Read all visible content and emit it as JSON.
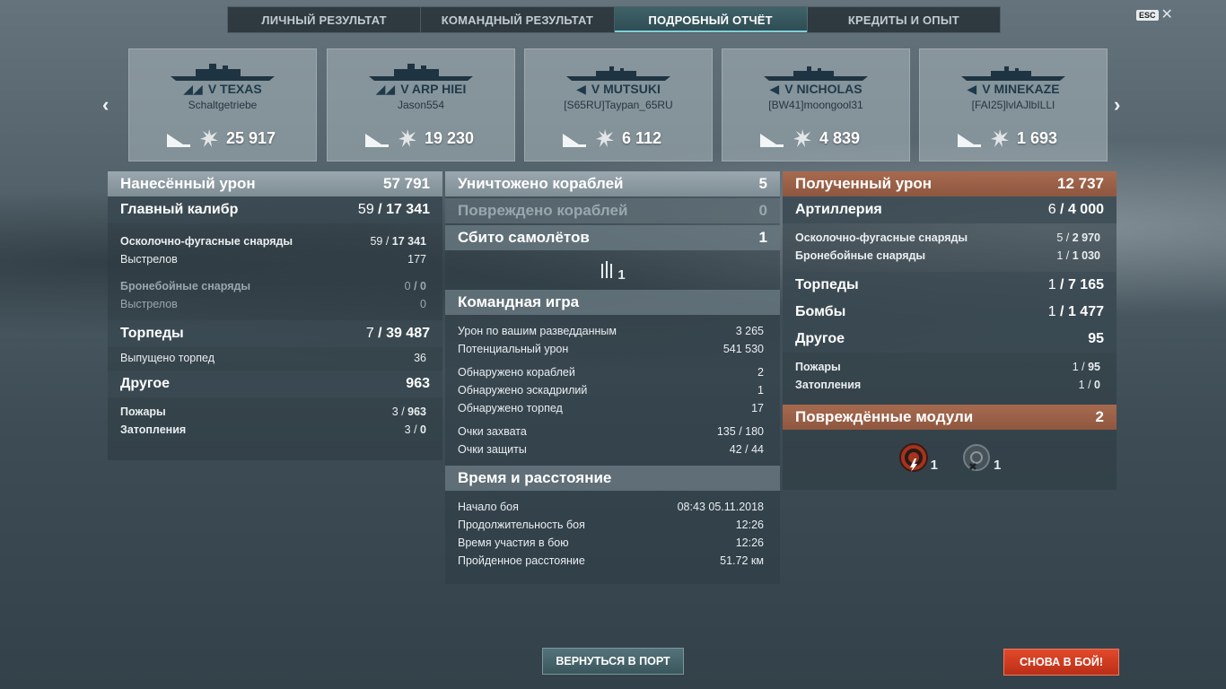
{
  "tabs": [
    "ЛИЧНЫЙ РЕЗУЛЬТАТ",
    "КОМАНДНЫЙ РЕЗУЛЬТАТ",
    "ПОДРОБНЫЙ ОТЧЁТ",
    "КРЕДИТЫ И ОПЫТ"
  ],
  "active_tab": 2,
  "esc_label": "ESC",
  "cards": [
    {
      "tier": "V",
      "ship": "TEXAS",
      "player": "Schaltgetriebe",
      "damage": "25 917",
      "ship_class": "battleship-icon"
    },
    {
      "tier": "V",
      "ship": "ARP HIEI",
      "player": "Jason554",
      "damage": "19 230",
      "ship_class": "battleship-icon"
    },
    {
      "tier": "V",
      "ship": "MUTSUKI",
      "player": "[S65RU]Taypan_65RU",
      "damage": "6 112",
      "ship_class": "destroyer-icon"
    },
    {
      "tier": "V",
      "ship": "NICHOLAS",
      "player": "[BW41]moongool31",
      "damage": "4 839",
      "ship_class": "destroyer-icon"
    },
    {
      "tier": "V",
      "ship": "MINEKAZE",
      "player": "[FAI25]lvlAJlbILLI",
      "damage": "1 693",
      "ship_class": "destroyer-icon"
    }
  ],
  "left": {
    "header": {
      "label": "Нанесённый урон",
      "value": "57 791"
    },
    "main_battery": {
      "label": "Главный калибр",
      "hits": "59",
      "dmg": "17 341"
    },
    "he": {
      "label": "Осколочно-фугасные снаряды",
      "hits": "59",
      "dmg": "17 341"
    },
    "he_shots": {
      "label": "Выстрелов",
      "value": "177"
    },
    "ap": {
      "label": "Бронебойные снаряды",
      "hits": "0",
      "dmg": "0"
    },
    "ap_shots": {
      "label": "Выстрелов",
      "value": "0"
    },
    "torpedoes": {
      "label": "Торпеды",
      "hits": "7",
      "dmg": "39 487"
    },
    "torps_launched": {
      "label": "Выпущено торпед",
      "value": "36"
    },
    "other": {
      "label": "Другое",
      "value": "963"
    },
    "fires": {
      "label": "Пожары",
      "hits": "3",
      "dmg": "963"
    },
    "floods": {
      "label": "Затопления",
      "hits": "3",
      "dmg": "0"
    }
  },
  "middle": {
    "destroyed": {
      "label": "Уничтожено кораблей",
      "value": "5"
    },
    "damaged": {
      "label": "Повреждено кораблей",
      "value": "0"
    },
    "planes": {
      "label": "Сбито самолётов",
      "value": "1"
    },
    "planes_icon_count": "1",
    "team": {
      "label": "Командная игра",
      "rows": [
        {
          "label": "Урон по вашим разведданным",
          "value": "3 265"
        },
        {
          "label": "Потенциальный урон",
          "value": "541 530"
        },
        {
          "label": "Обнаружено кораблей",
          "value": "2"
        },
        {
          "label": "Обнаружено эскадрилий",
          "value": "1"
        },
        {
          "label": "Обнаружено торпед",
          "value": "17"
        },
        {
          "label": "Очки захвата",
          "value": "135 / 180"
        },
        {
          "label": "Очки защиты",
          "value": "42 / 44"
        }
      ]
    },
    "time": {
      "label": "Время и расстояние",
      "rows": [
        {
          "label": "Начало боя",
          "value": "08:43  05.11.2018"
        },
        {
          "label": "Продолжительность боя",
          "value": "12:26"
        },
        {
          "label": "Время участия в бою",
          "value": "12:26"
        },
        {
          "label": "Пройденное расстояние",
          "value": "51.72 км"
        }
      ]
    }
  },
  "right": {
    "header": {
      "label": "Полученный урон",
      "value": "12 737"
    },
    "artillery": {
      "label": "Артиллерия",
      "hits": "6",
      "dmg": "4 000"
    },
    "he": {
      "label": "Осколочно-фугасные снаряды",
      "hits": "5",
      "dmg": "2 970"
    },
    "ap": {
      "label": "Бронебойные снаряды",
      "hits": "1",
      "dmg": "1 030"
    },
    "torpedoes": {
      "label": "Торпеды",
      "hits": "1",
      "dmg": "7 165"
    },
    "bombs": {
      "label": "Бомбы",
      "hits": "1",
      "dmg": "1 477"
    },
    "other": {
      "label": "Другое",
      "value": "95"
    },
    "fires": {
      "label": "Пожары",
      "hits": "1",
      "dmg": "95"
    },
    "floods": {
      "label": "Затопления",
      "hits": "1",
      "dmg": "0"
    },
    "modules": {
      "label": "Повреждённые модули",
      "value": "2",
      "engine_count": "1",
      "steering_count": "1"
    }
  },
  "buttons": {
    "port": "ВЕРНУТЬСЯ В ПОРТ",
    "battle": "СНОВА В БОЙ!"
  },
  "colors": {
    "accent_tab": "#7fd0d8",
    "received_header": "#9b6047",
    "battle_button": "#d43c21"
  }
}
